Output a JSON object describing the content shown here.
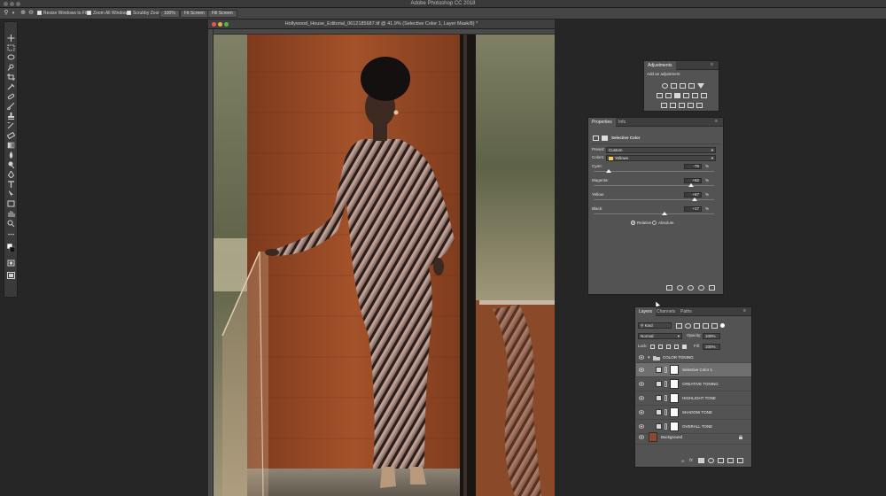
{
  "app": {
    "title": "Adobe Photoshop CC 2018"
  },
  "options_bar": {
    "resize_windows": "Resize Windows to Fit",
    "zoom_all": "Zoom All Windows",
    "scrubby_zoom": "Scrubby Zoom",
    "zoom_100": "100%",
    "fit_screen": "Fit Screen",
    "fill_screen": "Fill Screen"
  },
  "document": {
    "title": "Hollywood_House_Editorial_0612185687.tif @ 41.9% (Selective Color 1, Layer Mask/8) *"
  },
  "adjustments_panel": {
    "tab": "Adjustments",
    "add_label": "Add an adjustment"
  },
  "properties_panel": {
    "tabs": [
      "Properties",
      "Info"
    ],
    "heading": "Selective Color",
    "preset_label": "Preset:",
    "preset_value": "Custom",
    "colors_label": "Colors:",
    "colors_value": "Yellows",
    "colors_swatch": "#f2d23a",
    "sliders": [
      {
        "label": "Cyan:",
        "value": "-75",
        "unit": "%",
        "position": 0.125
      },
      {
        "label": "Magenta:",
        "value": "+62",
        "unit": "%",
        "position": 0.81
      },
      {
        "label": "Yellow:",
        "value": "+67",
        "unit": "%",
        "position": 0.835
      },
      {
        "label": "Black:",
        "value": "+17",
        "unit": "%",
        "position": 0.585
      }
    ],
    "method_relative": "Relative",
    "method_absolute": "Absolute"
  },
  "layers_panel": {
    "tabs": [
      "Layers",
      "Channels",
      "Paths"
    ],
    "kind_filter": "Kind",
    "blend_mode": "Normal",
    "opacity_label": "Opacity:",
    "opacity_value": "100%",
    "lock_label": "Lock:",
    "fill_label": "Fill:",
    "fill_value": "100%",
    "group_name": "COLOR TONING",
    "layers": [
      {
        "name": "Selective Color 1",
        "selected": true
      },
      {
        "name": "CREATIVE TONING",
        "selected": false
      },
      {
        "name": "HIGHLIGHT TONE",
        "selected": false
      },
      {
        "name": "SHADOW TONE",
        "selected": false
      },
      {
        "name": "OVERALL TONE",
        "selected": false
      }
    ],
    "background_name": "Background"
  },
  "colors": {
    "wall": "#9c4a24",
    "accent": "#6f6f6f"
  }
}
